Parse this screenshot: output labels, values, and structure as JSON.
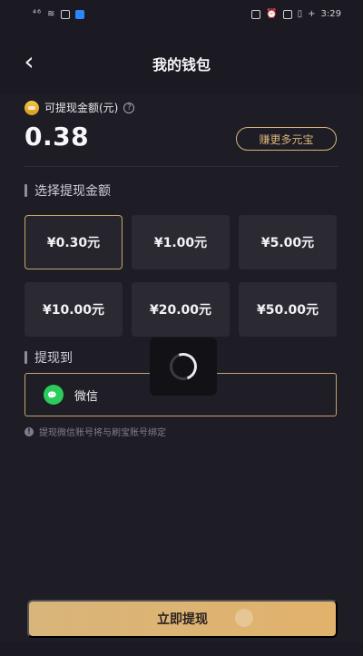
{
  "status_bar": {
    "left": "⁴⁶",
    "right_time": "3:29",
    "battery": "▯",
    "plus": "+"
  },
  "nav": {
    "title": "我的钱包",
    "back_icon": "chevron-left-icon"
  },
  "balance": {
    "label": "可提现金额(元)",
    "amount": "0.38",
    "earn_button": "赚更多元宝",
    "coin_color": "#f5c74b"
  },
  "select_amount": {
    "title": "选择提现金额",
    "options": [
      {
        "label": "¥0.30元",
        "selected": true
      },
      {
        "label": "¥1.00元",
        "selected": false
      },
      {
        "label": "¥5.00元",
        "selected": false
      },
      {
        "label": "¥10.00元",
        "selected": false
      },
      {
        "label": "¥20.00元",
        "selected": false
      },
      {
        "label": "¥50.00元",
        "selected": false
      }
    ],
    "accent": "#c7a46c"
  },
  "withdraw_to": {
    "title": "提现到",
    "method": "微信",
    "hint": "提现微信账号将与刷宝账号绑定",
    "wechat_color": "#2bcc5a"
  },
  "cta": {
    "label": "立即提现",
    "gold": "#d8b57a"
  },
  "loading": {
    "icon": "loading-spinner-icon"
  }
}
